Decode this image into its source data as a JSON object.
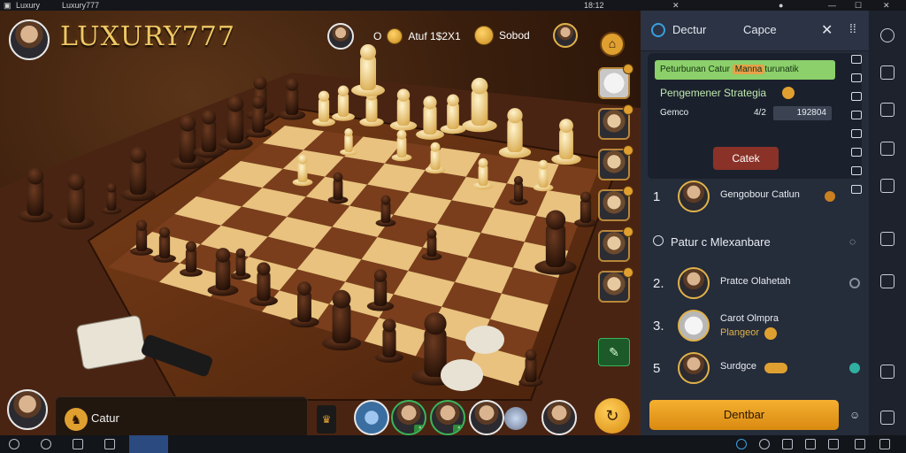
{
  "top_bar": {
    "left_label_1": "Luxury",
    "left_label_2": "Luxury777",
    "right_label": "18:12"
  },
  "game": {
    "logo": "LUXURY777",
    "opponent_label": "O",
    "status_text": "Atuf 1$2X1",
    "chat_label": "Sobod",
    "bottom_label": "Catur",
    "strip_badges": [
      "1",
      "1"
    ]
  },
  "panel": {
    "tabs": [
      "Dectur",
      "Capce"
    ],
    "card": {
      "green_line_prefix": "Peturbunan Catur",
      "green_line_highlight": "Manna",
      "green_line_suffix": "turunatik",
      "strategy_label": "Pengemener Strategia",
      "game_label": "Gemco",
      "game_value_small": "4/2",
      "game_value": "192804",
      "button": "Catek"
    },
    "top_entry": {
      "rank": "1",
      "name": "Gengobour Catlun"
    },
    "section_title": "Patur c Mlexanbare",
    "entries": [
      {
        "rank": "2.",
        "name": "Pratce Olahetah",
        "sub": ""
      },
      {
        "rank": "3.",
        "name": "Carot Olmpra",
        "sub": "Plangeor"
      },
      {
        "rank": "5",
        "name": "Surdgce",
        "sub": ""
      }
    ],
    "primary_button": "Dentbar"
  },
  "colors": {
    "accent_gold": "#e0b24a",
    "panel_bg": "#252c3a",
    "button_orange": "#e8a020",
    "button_red": "#8a3228",
    "highlight_green": "#8bd06a"
  }
}
